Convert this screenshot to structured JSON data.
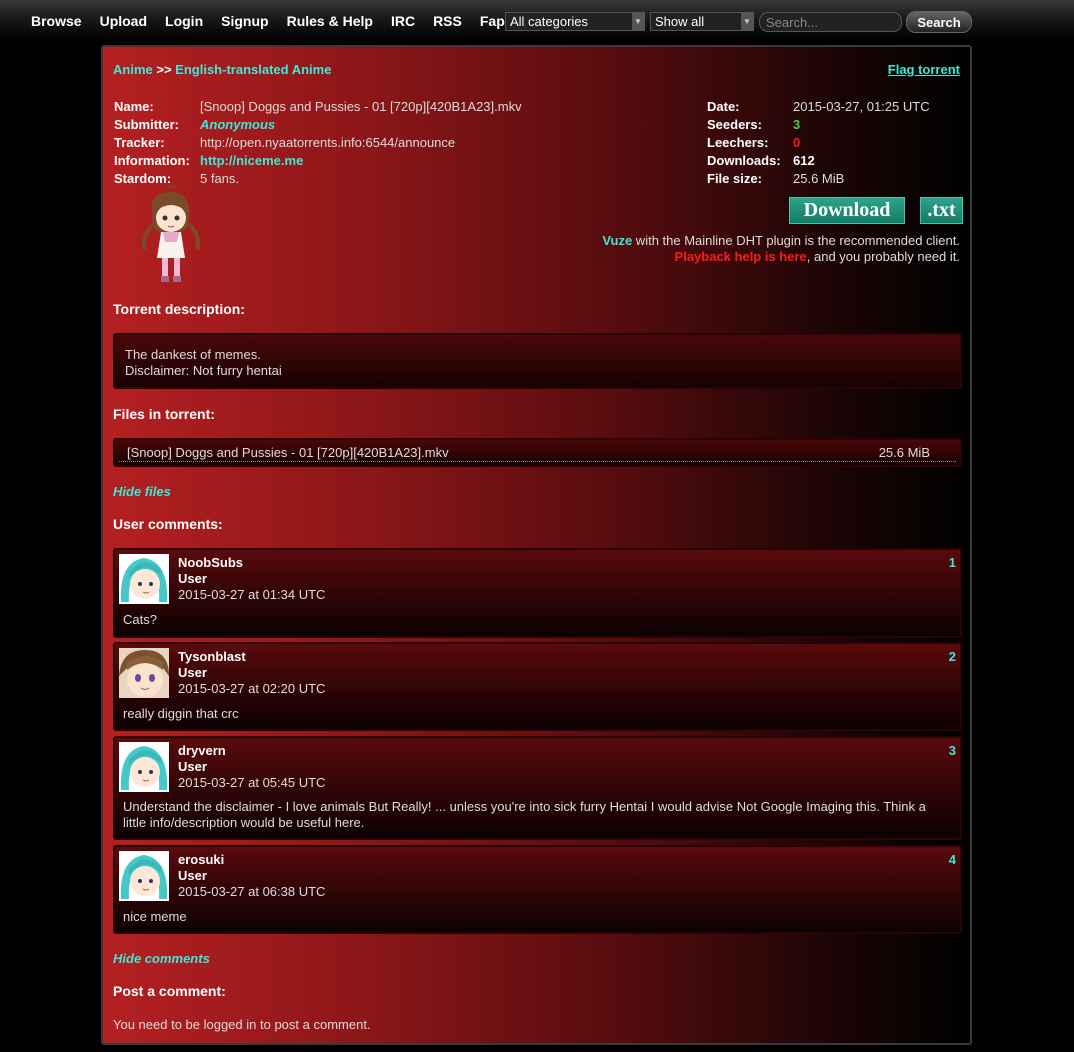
{
  "nav": {
    "links": [
      "Browse",
      "Upload",
      "Login",
      "Signup",
      "Rules & Help",
      "IRC",
      "RSS",
      "Fap"
    ],
    "category_select": "All categories",
    "filter_select": "Show all",
    "search_placeholder": "Search...",
    "search_button": "Search"
  },
  "breadcrumb": {
    "category": "Anime",
    "separator": ">>",
    "subcategory": "English-translated Anime"
  },
  "flag_link": "Flag torrent",
  "details_left": {
    "name_label": "Name:",
    "name": "[Snoop] Doggs and Pussies - 01 [720p][420B1A23].mkv",
    "submitter_label": "Submitter:",
    "submitter": "Anonymous",
    "tracker_label": "Tracker:",
    "tracker": "http://open.nyaatorrents.info:6544/announce",
    "information_label": "Information:",
    "information": "http://niceme.me",
    "stardom_label": "Stardom:",
    "stardom": "5 fans."
  },
  "details_right": {
    "date_label": "Date:",
    "date": "2015-03-27, 01:25 UTC",
    "seeders_label": "Seeders:",
    "seeders": "3",
    "leechers_label": "Leechers:",
    "leechers": "0",
    "downloads_label": "Downloads:",
    "downloads": "612",
    "filesize_label": "File size:",
    "filesize": "25.6 MiB"
  },
  "buttons": {
    "download": "Download",
    "txt": ".txt"
  },
  "client_note": {
    "vuze": "Vuze",
    "vuze_rest": " with the Mainline DHT plugin is the recommended client.",
    "playback": "Playback help is here",
    "playback_rest": ", and you probably need it."
  },
  "description": {
    "heading": "Torrent description:",
    "line1": "The dankest of memes.",
    "line2": "Disclaimer: Not furry hentai"
  },
  "files": {
    "heading": "Files in torrent:",
    "items": [
      {
        "name": "[Snoop] Doggs and Pussies - 01 [720p][420B1A23].mkv",
        "size": "25.6 MiB"
      }
    ],
    "hide_link": "Hide files"
  },
  "comments": {
    "heading": "User comments:",
    "items": [
      {
        "num": "1",
        "user": "NoobSubs",
        "role": "User",
        "date": "2015-03-27 at 01:34 UTC",
        "text": "Cats?",
        "avatar": "miku-avatar"
      },
      {
        "num": "2",
        "user": "Tysonblast",
        "role": "User",
        "date": "2015-03-27 at 02:20 UTC",
        "text": "really diggin that crc",
        "avatar": "brown-hair-avatar"
      },
      {
        "num": "3",
        "user": "dryvern",
        "role": "User",
        "date": "2015-03-27 at 05:45 UTC",
        "text": "Understand the disclaimer - I love animals But Really! ... unless you're into sick furry Hentai I would advise Not Google Imaging this. Think a little info/description would be useful here.",
        "avatar": "miku-avatar"
      },
      {
        "num": "4",
        "user": "erosuki",
        "role": "User",
        "date": "2015-03-27 at 06:38 UTC",
        "text": "nice meme",
        "avatar": "miku-avatar"
      }
    ],
    "hide_link": "Hide comments"
  },
  "post": {
    "heading": "Post a comment:",
    "message": "You need to be logged in to post a comment."
  },
  "colors": {
    "accent_cyan": "#3ee8d6",
    "seeders_green": "#3fd43f",
    "leechers_red": "#ff1a1a",
    "panel_red": "#b52022"
  }
}
